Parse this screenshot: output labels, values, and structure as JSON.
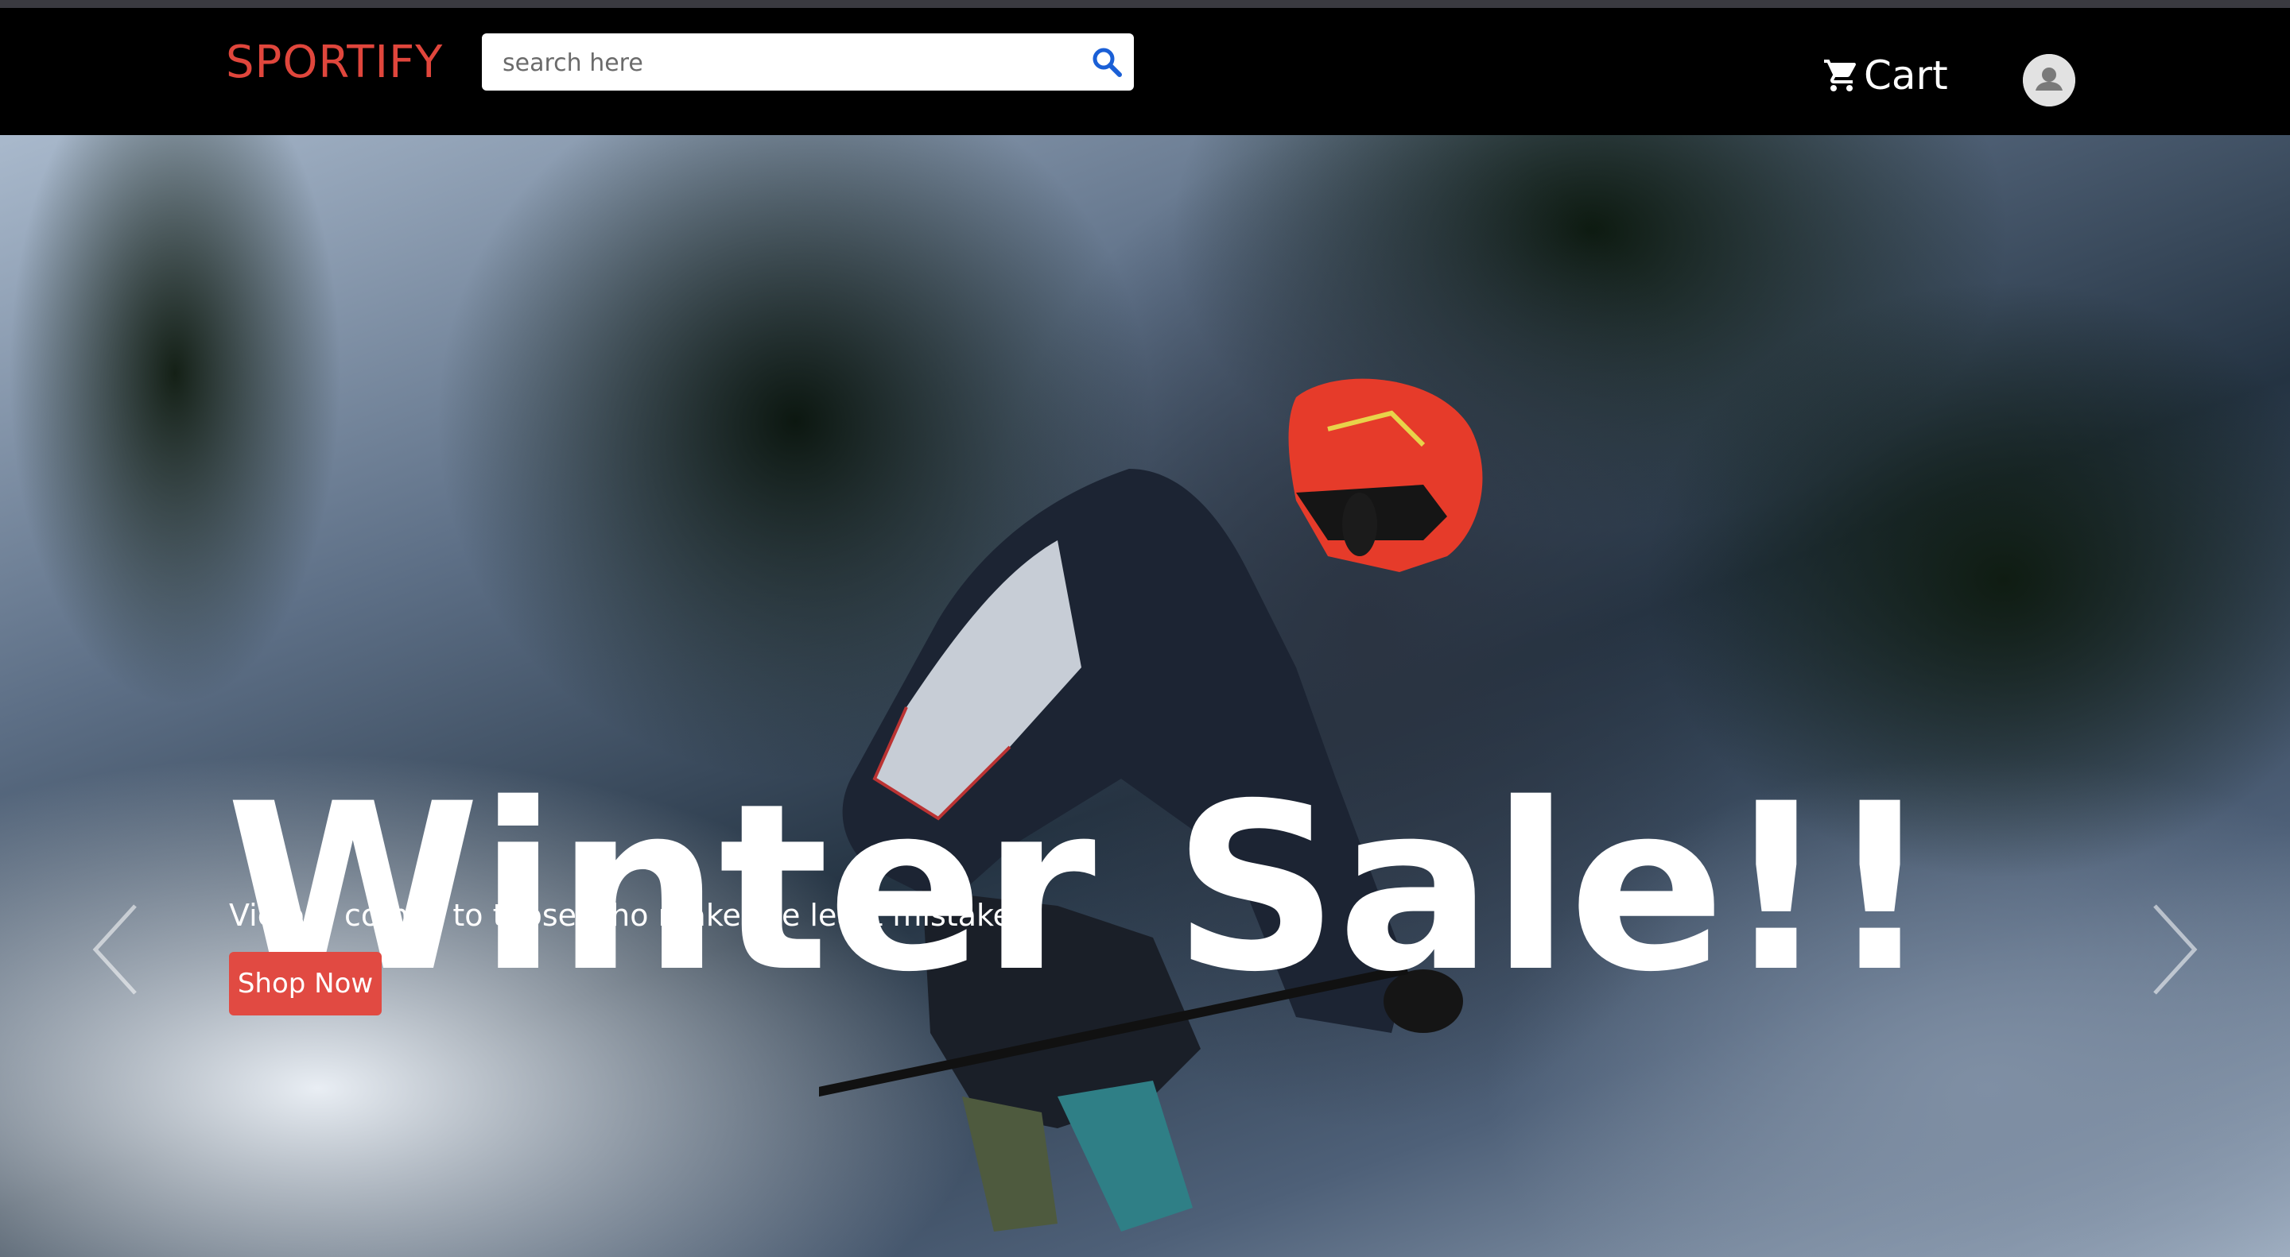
{
  "header": {
    "brand": "SPORTIFY",
    "search": {
      "placeholder": "search here",
      "value": ""
    },
    "cart_label": "Cart"
  },
  "hero": {
    "title": "Winter Sale!!",
    "subtitle": "Victory comes to those who make the least mistakes.",
    "cta_label": "Shop Now"
  },
  "colors": {
    "brand": "#e0463c",
    "cta": "#e14a42",
    "navbar": "#000000",
    "search_icon": "#1a5fd6"
  },
  "icons": [
    "search-icon",
    "cart-icon",
    "user-avatar-icon",
    "chevron-left-icon",
    "chevron-right-icon"
  ]
}
